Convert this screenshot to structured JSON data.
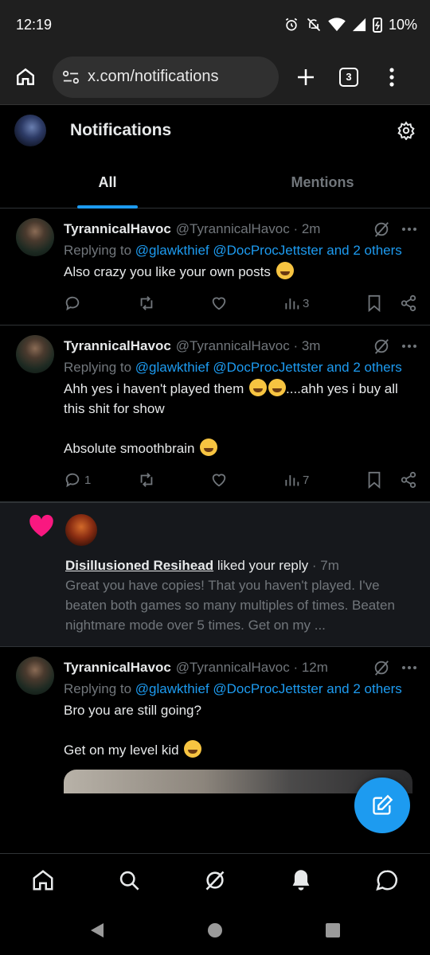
{
  "status_bar": {
    "time": "12:19",
    "battery": "10%"
  },
  "browser": {
    "url": "x.com/notifications",
    "tab_count": "3"
  },
  "header": {
    "title": "Notifications"
  },
  "tabs": [
    {
      "label": "All",
      "active": true
    },
    {
      "label": "Mentions",
      "active": false
    }
  ],
  "posts": [
    {
      "name": "TyrannicalHavoc",
      "handle": "@TyrannicalHavoc · 2m",
      "replying_prefix": "Replying to ",
      "replying_links": "@glawkthief @DocProcJettster and 2 others",
      "text1": "Also crazy you like your own posts",
      "replies": "",
      "views": "3"
    },
    {
      "name": "TyrannicalHavoc",
      "handle": "@TyrannicalHavoc · 3m",
      "replying_prefix": "Replying to ",
      "replying_links": "@glawkthief @DocProcJettster and 2 others",
      "text1": "Ahh yes i haven't played them",
      "text1_tail": "....ahh yes i buy all this shit for show",
      "text2": "Absolute smoothbrain",
      "replies": "1",
      "views": "7"
    },
    {
      "name": "TyrannicalHavoc",
      "handle": "@TyrannicalHavoc · 12m",
      "replying_prefix": "Replying to ",
      "replying_links": "@glawkthief @DocProcJettster and 2 others",
      "text1": "Bro you are still going?",
      "text2": "Get on my level kid"
    }
  ],
  "like_notification": {
    "user": "Disillusioned Resihead",
    "action": " liked your reply",
    "time": " · 7m",
    "preview": "Great you have copies! That you haven't played. I've beaten both games so many multiples of times. Beaten nightmare mode over 5 times. Get on my ..."
  },
  "colors": {
    "accent": "#1d9bf0",
    "like": "#f91880",
    "muted": "#71767b"
  },
  "icons": [
    "home-icon",
    "search-icon",
    "grok-icon",
    "bell-icon",
    "chat-icon",
    "compose-icon",
    "gear-icon"
  ]
}
